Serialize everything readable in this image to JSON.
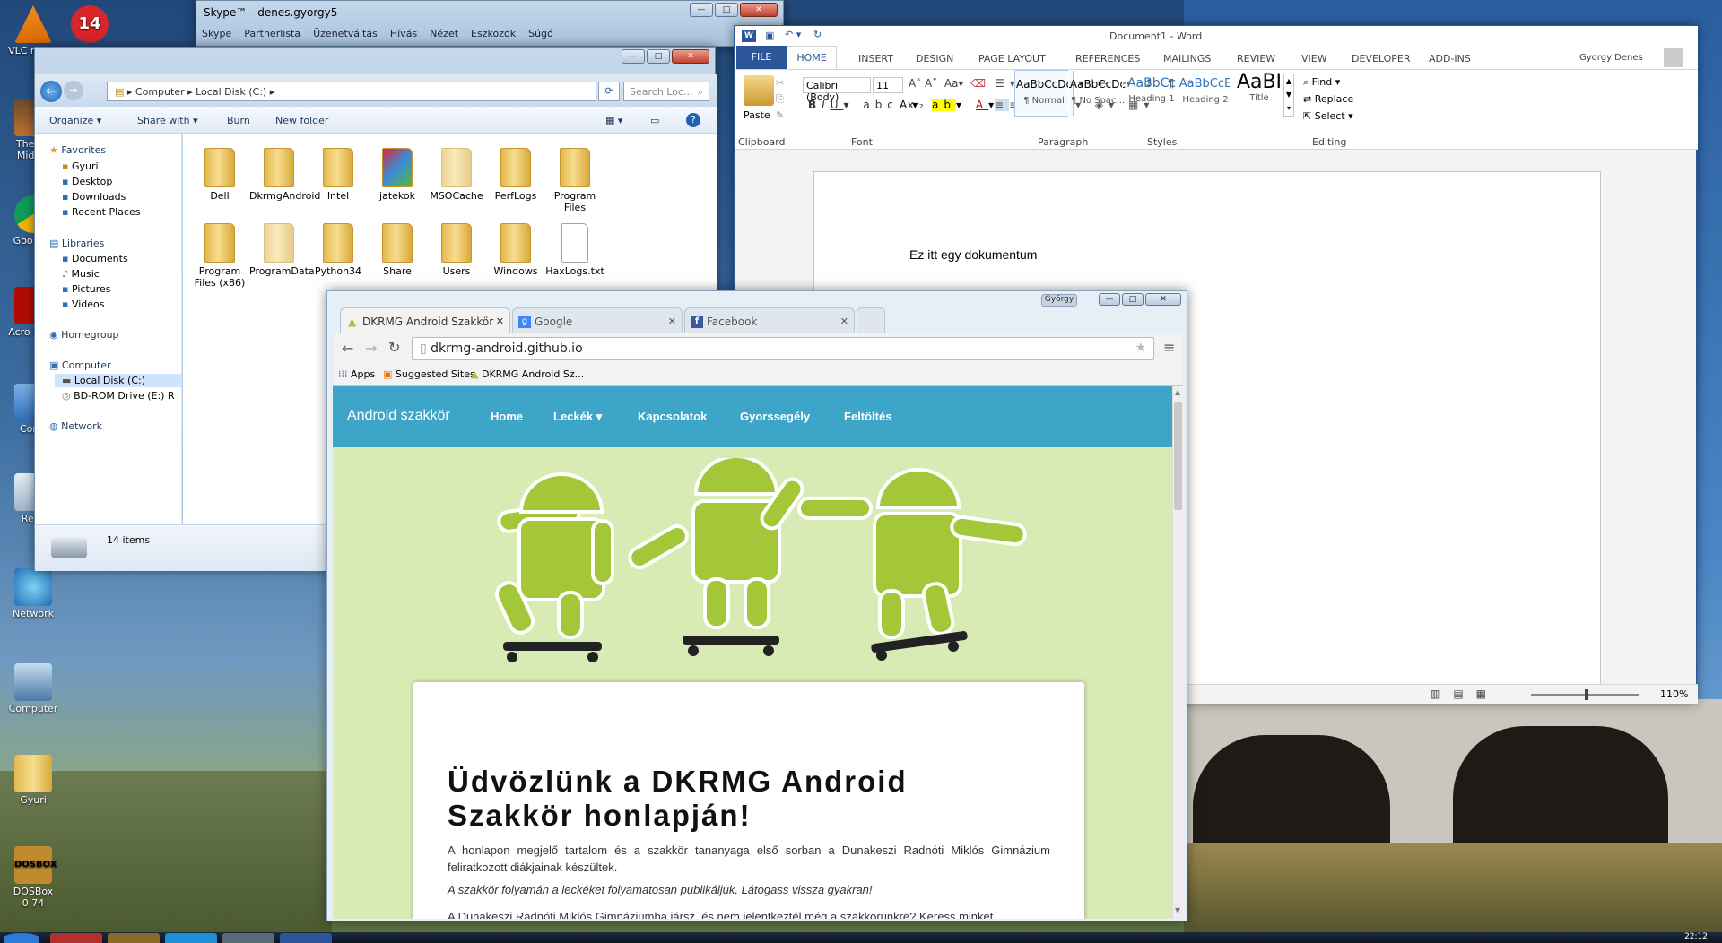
{
  "desktop": {
    "icons": [
      "VLC m pla",
      "The Ba Middle",
      "Goo Chr",
      "Acro Read",
      "Contr",
      "Recy",
      "Network",
      "Computer",
      "Gyuri",
      "DOSBox 0.74"
    ],
    "badge_icon_label": "14"
  },
  "taskbar": {
    "clock": "22:12"
  },
  "skype": {
    "title": "Skype™ - denes.gyorgy5",
    "menu": [
      "Skype",
      "Partnerlista",
      "Üzenetváltás",
      "Hívás",
      "Nézet",
      "Eszközök",
      "Súgó"
    ]
  },
  "explorer": {
    "breadcrumb": [
      "Computer",
      "Local Disk (C:)"
    ],
    "search_placeholder": "Search Loc...",
    "toolbar": {
      "organize": "Organize",
      "share_with": "Share with",
      "burn": "Burn",
      "new_folder": "New folder"
    },
    "sidebar": {
      "favorites": "Favorites",
      "favorites_items": [
        "Gyuri",
        "Desktop",
        "Downloads",
        "Recent Places"
      ],
      "libraries": "Libraries",
      "libraries_items": [
        "Documents",
        "Music",
        "Pictures",
        "Videos"
      ],
      "homegroup": "Homegroup",
      "computer": "Computer",
      "computer_items": [
        "Local Disk (C:)",
        "BD-ROM Drive (E:) R"
      ],
      "network": "Network"
    },
    "files": [
      "Dell",
      "DkrmgAndroid",
      "Intel",
      "jatekok",
      "MSOCache",
      "PerfLogs",
      "Program Files",
      "Program Files (x86)",
      "ProgramData",
      "Python34",
      "Share",
      "Users",
      "Windows",
      "HaxLogs.txt"
    ],
    "status": "14 items"
  },
  "word": {
    "title": "Document1 - Word",
    "tabs": [
      "FILE",
      "HOME",
      "INSERT",
      "DESIGN",
      "PAGE LAYOUT",
      "REFERENCES",
      "MAILINGS",
      "REVIEW",
      "VIEW",
      "DEVELOPER",
      "ADD-INS"
    ],
    "user": "Gyorgy Denes",
    "font_name": "Calibri (Body)",
    "font_size": "11",
    "paste": "Paste",
    "groups": [
      "Clipboard",
      "Font",
      "Paragraph",
      "Styles",
      "Editing"
    ],
    "styles": [
      {
        "sample": "AaBbCcDc",
        "name": "¶ Normal"
      },
      {
        "sample": "AaBbCcDc",
        "name": "¶ No Spac..."
      },
      {
        "sample": "AaBbCc",
        "name": "Heading 1"
      },
      {
        "sample": "AaBbCcE",
        "name": "Heading 2"
      },
      {
        "sample": "AaBI",
        "name": "Title"
      }
    ],
    "editing": [
      "Find",
      "Replace",
      "Select"
    ],
    "document_text": "Ez itt egy dokumentum",
    "zoom": "110%"
  },
  "chrome": {
    "profile": "György",
    "tabs": [
      "DKRMG Android Szakkör",
      "Google",
      "Facebook"
    ],
    "url": "dkrmg-android.github.io",
    "bookmarks": [
      "Apps",
      "Suggested Sites",
      "DKRMG Android Sz..."
    ],
    "site": {
      "brand": "Android szakkör",
      "nav": [
        "Home",
        "Leckék",
        "Kapcsolatok",
        "Gyorssegély",
        "Feltöltés"
      ],
      "heading": "Üdvözlünk a DKRMG Android Szakkör honlapján!",
      "para1": "A honlapon megjelő tartalom és a szakkör tananyaga első sorban a Dunakeszi Radnóti Miklós Gimnázium feliratkozott diákjainak készültek.",
      "para2": "A szakkör folyamán a leckéket folyamatosan publikáljuk. Látogass vissza gyakran!",
      "para3": "A Dunakeszi Radnóti Miklós Gimnáziumba jársz, és nem jelentkeztél még a szakkörünkre? Keress minket"
    }
  },
  "colors": {
    "navbar": "#3da5c8",
    "android_green": "#a4c639",
    "word_blue": "#2b579a"
  }
}
